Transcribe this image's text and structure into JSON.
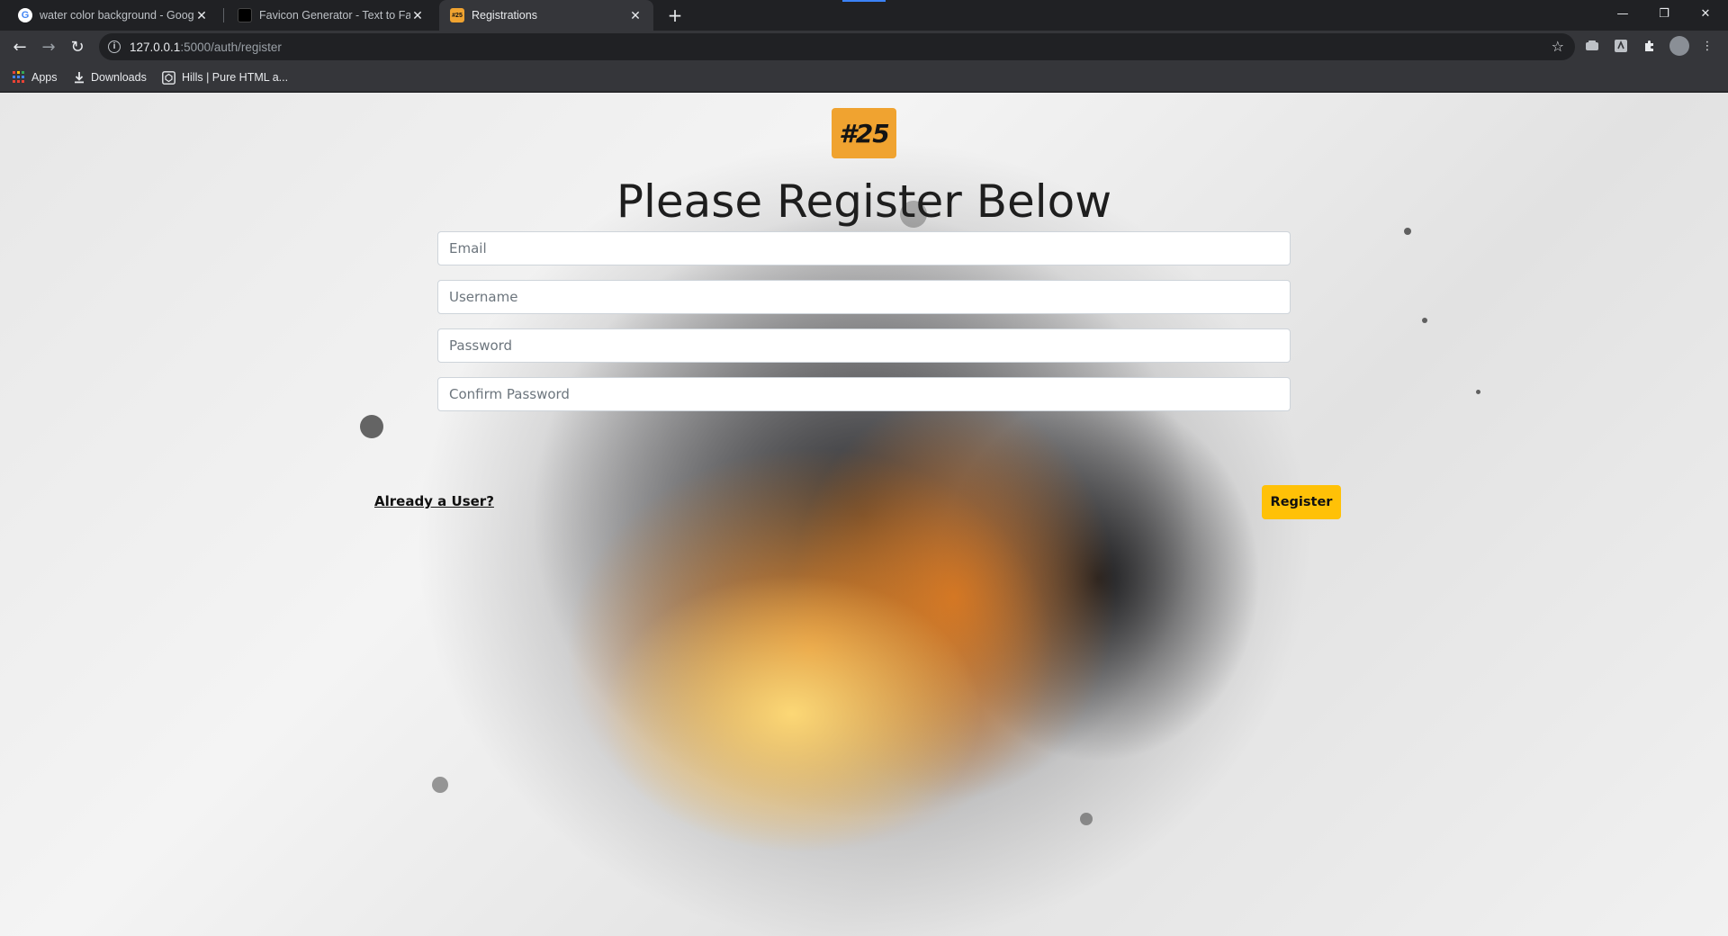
{
  "browser": {
    "tabs": [
      {
        "title": "water color background - Google",
        "active": false
      },
      {
        "title": "Favicon Generator - Text to Favic",
        "active": false
      },
      {
        "title": "Registrations",
        "active": true
      }
    ],
    "new_tab_symbol": "+",
    "url_host": "127.0.0.1",
    "url_path": ":5000/auth/register",
    "bookmarks": [
      {
        "label": "Apps",
        "icon": "apps-grid-icon"
      },
      {
        "label": "Downloads",
        "icon": "download-icon"
      },
      {
        "label": "Hills | Pure HTML a...",
        "icon": "codepen-icon"
      }
    ]
  },
  "page": {
    "logo_text": "#25",
    "heading": "Please Register Below",
    "fields": {
      "email_placeholder": "Email",
      "username_placeholder": "Username",
      "password_placeholder": "Password",
      "confirm_placeholder": "Confirm Password"
    },
    "login_link": "Already a User?",
    "register_button": "Register"
  },
  "colors": {
    "accent": "#ffc107",
    "logo_bg": "#f0a330",
    "chrome_dark": "#202124",
    "chrome_toolbar": "#35363a"
  }
}
